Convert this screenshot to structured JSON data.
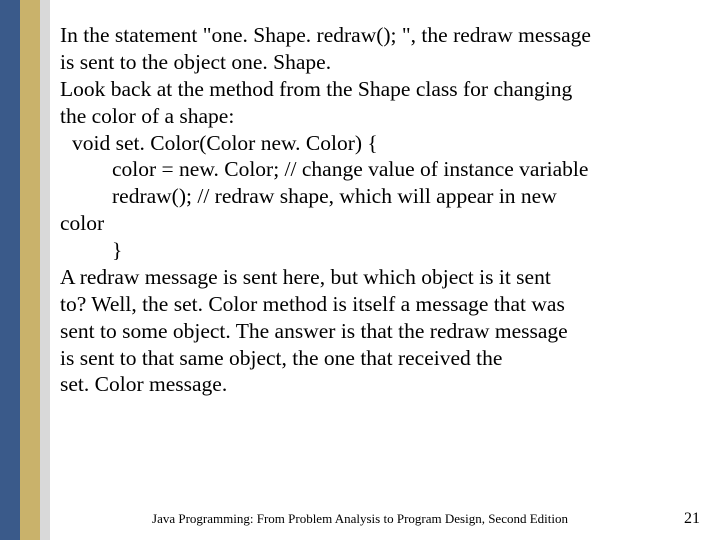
{
  "lines": [
    {
      "cls": "",
      "text": "In the statement \"one. Shape. redraw(); \", the redraw message"
    },
    {
      "cls": "",
      "text": "is sent to the object one. Shape."
    },
    {
      "cls": "",
      "text": "Look back at the method from the Shape class for changing"
    },
    {
      "cls": "",
      "text": "the color of a shape:"
    },
    {
      "cls": "indent1",
      "text": "void set. Color(Color new. Color) {"
    },
    {
      "cls": "indent2",
      "text": "color = new. Color; // change value of instance variable"
    },
    {
      "cls": "indent2",
      "text": "redraw(); // redraw shape, which will appear in new"
    },
    {
      "cls": "",
      "text": "color"
    },
    {
      "cls": "indent2",
      "text": "}"
    },
    {
      "cls": "",
      "text": "A redraw message is sent here, but which object is it sent"
    },
    {
      "cls": "",
      "text": "to? Well, the set. Color method is itself a message that was"
    },
    {
      "cls": "",
      "text": "sent to some object. The answer is that the redraw message"
    },
    {
      "cls": "",
      "text": "is sent to that same object, the one that received the"
    },
    {
      "cls": "",
      "text": "set. Color message."
    }
  ],
  "footer": {
    "title": "Java Programming: From Problem Analysis to Program Design, Second Edition",
    "page": "21"
  }
}
